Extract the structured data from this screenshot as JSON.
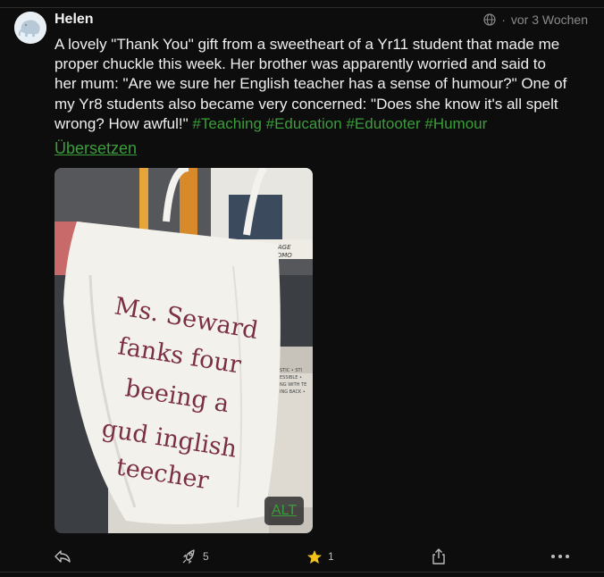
{
  "author": {
    "name": "Helen"
  },
  "meta": {
    "visibility_icon": "globe-icon",
    "time": "vor 3 Wochen"
  },
  "post": {
    "text_lines": [
      "A lovely \"Thank You\" gift from a sweetheart of a Yr11 student that made me",
      "proper chuckle this week. Her brother was apparently worried and said to",
      "her mum: \"Are we sure her English teacher has a sense of humour?\" One of",
      "my Yr8 students also became very concerned: \"Does she know it's all spelt",
      "wrong? How awful!\""
    ],
    "hashtags": [
      "#Teaching",
      "#Education",
      "#Edutooter",
      "#Humour"
    ],
    "translate_label": "Übersetzen"
  },
  "media": {
    "bag_text": [
      "Ms. Seward",
      "fanks four",
      "beeing a",
      "gud inglish",
      "teecher"
    ],
    "board_text": "ME MOTI   TIME MANAGE",
    "board_text2": "ONOMO",
    "side_text": [
      "STIC • STI",
      "ESSIBLE •",
      "NG WITH TE",
      "ING BACK •"
    ],
    "alt_label": "ALT"
  },
  "actions": {
    "reply_icon": "reply-icon",
    "boost_icon": "boost-rocket-icon",
    "boost_count": "5",
    "favourite_icon": "star-icon",
    "favourite_count": "1",
    "share_icon": "share-icon",
    "more_icon": "more-icon"
  },
  "colors": {
    "background": "#0d0d0d",
    "accent": "#3a9e3a",
    "star": "#f2c21a"
  }
}
